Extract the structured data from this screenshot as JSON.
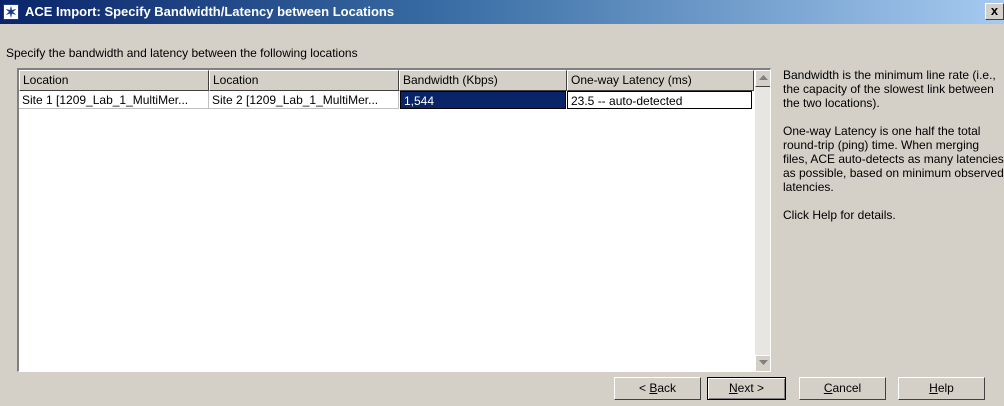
{
  "window": {
    "title": "ACE Import: Specify Bandwidth/Latency between Locations",
    "close_glyph": "x",
    "app_icon_glyph": "✶"
  },
  "instruction": "Specify the bandwidth and latency between the following locations",
  "table": {
    "columns": [
      "Location",
      "Location",
      "Bandwidth (Kbps)",
      "One-way Latency (ms)"
    ],
    "rows": [
      {
        "location_a": "Site 1 [1209_Lab_1_MultiMer...",
        "location_b": "Site 2 [1209_Lab_1_MultiMer...",
        "bandwidth": "1,544",
        "latency": "23.5 -- auto-detected"
      }
    ]
  },
  "help": {
    "p1": "Bandwidth is the minimum line rate (i.e., the capacity of the slowest link between the two locations).",
    "p2": "One-way Latency is one half the total round-trip (ping) time.  When merging files, ACE auto-detects as many latencies as possible, based on minimum observed latencies.",
    "p3": "Click Help for details."
  },
  "buttons": {
    "back": {
      "pre": "< ",
      "key": "B",
      "post": "ack"
    },
    "next": {
      "pre": "",
      "key": "N",
      "post": "ext >"
    },
    "cancel": {
      "pre": "",
      "key": "C",
      "post": "ancel"
    },
    "help": {
      "pre": "",
      "key": "H",
      "post": "elp"
    }
  },
  "colors": {
    "title_gradient_start": "#0a246a",
    "title_gradient_end": "#a6caf0",
    "selection": "#0a246a",
    "dialog_face": "#d4d0c8"
  }
}
